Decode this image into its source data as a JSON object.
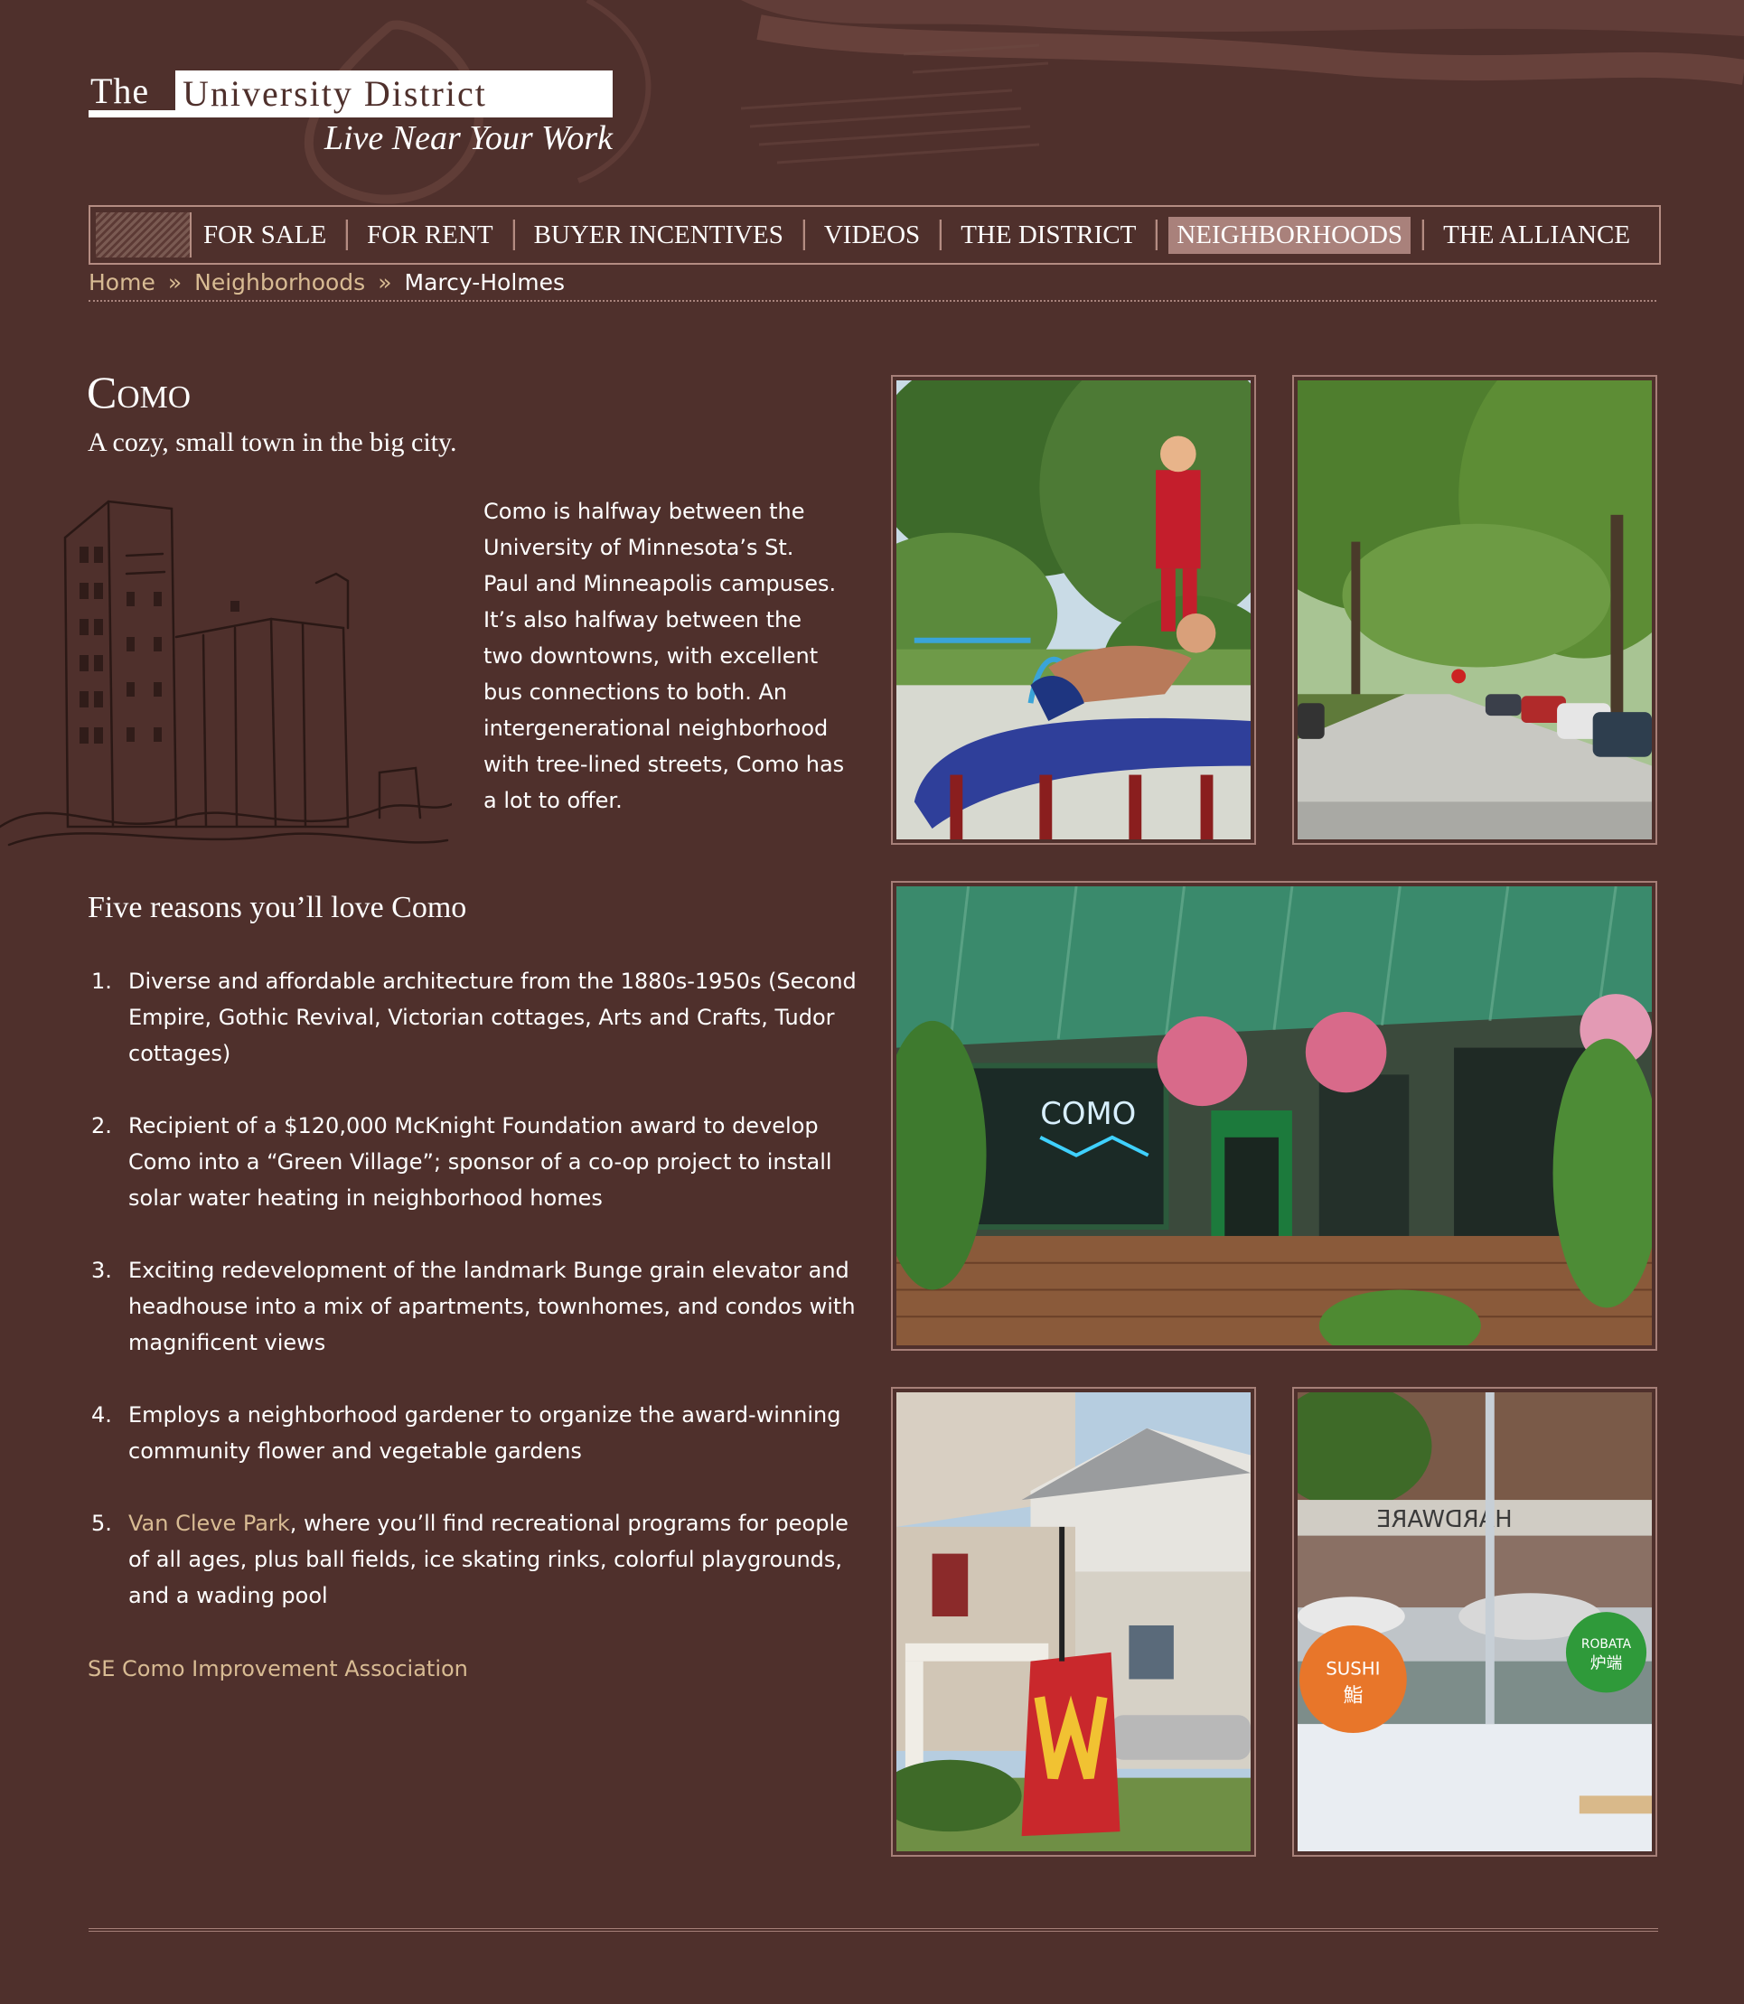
{
  "logo": {
    "the": "The",
    "name": "University District",
    "tagline": "Live Near Your Work"
  },
  "nav": {
    "items": [
      {
        "label": "FOR SALE",
        "active": false
      },
      {
        "label": "FOR RENT",
        "active": false
      },
      {
        "label": "BUYER INCENTIVES",
        "active": false
      },
      {
        "label": "VIDEOS",
        "active": false
      },
      {
        "label": "THE DISTRICT",
        "active": false
      },
      {
        "label": "NEIGHBORHOODS",
        "active": true
      },
      {
        "label": "THE ALLIANCE",
        "active": false
      }
    ]
  },
  "breadcrumb": {
    "home": "Home",
    "section": "Neighborhoods",
    "current": "Marcy-Holmes",
    "separator": "»"
  },
  "page": {
    "title": "Como",
    "subtitle": "A cozy, small town in the big city.",
    "intro": "Como is halfway between the University of Minnesota’s St. Paul and Minneapolis campuses. It’s also halfway between the two downtowns, with excellent bus connections to both. An intergenerational neighborhood with tree-lined streets, Como has a lot to offer."
  },
  "reasons": {
    "heading": "Five reasons you’ll love Como",
    "items": [
      {
        "num": "1.",
        "text": "Diverse and affordable architecture from the 1880s-1950s (Second Empire, Gothic Revival, Victorian cottages, Arts and Crafts, Tudor cottages)"
      },
      {
        "num": "2.",
        "text": "Recipient of a $120,000 McKnight Foundation award to develop Como into a “Green Village”; sponsor of a co-op project to install solar water heating in neighborhood homes"
      },
      {
        "num": "3.",
        "text": "Exciting redevelopment of the landmark Bunge grain elevator and headhouse into a mix of apartments, townhomes, and condos with magnificent views"
      },
      {
        "num": "4.",
        "text": "Employs a neighborhood gardener to organize the award-winning community flower and vegetable gardens"
      },
      {
        "num": "5.",
        "link": "Van Cleve Park",
        "text": ", where you’ll find recreational programs for people of all ages, plus ball fields, ice skating rinks, colorful playgrounds, and a wading pool"
      }
    ],
    "association_link": "SE Como Improvement Association"
  },
  "photos": {
    "storefront_sign": "COMO",
    "sushi_sign": "SUSHI",
    "sushi_cjk": "鮨",
    "robata_sign": "ROBATA",
    "robata_cjk": "炉端",
    "hardware_sign": "HARDWARE"
  },
  "colors": {
    "background": "#4f302c",
    "link": "#d8bb93",
    "border": "#a67f78",
    "nav_active": "#a9817b"
  }
}
